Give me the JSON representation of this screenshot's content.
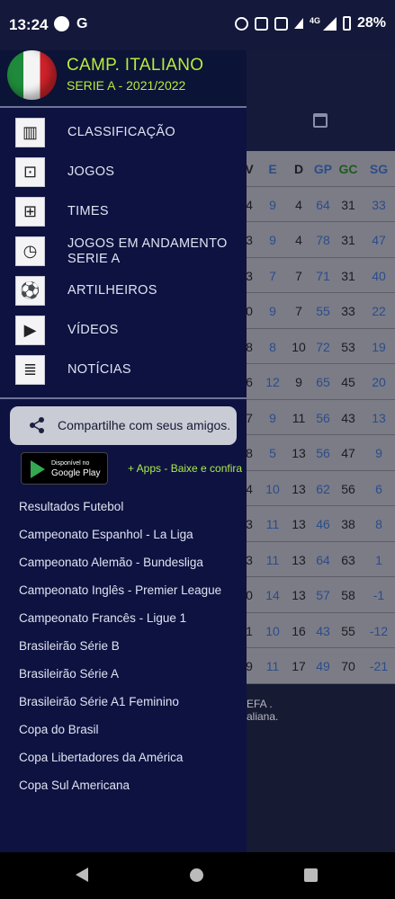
{
  "status_bar": {
    "time": "13:24",
    "google_letter": "G",
    "network": "4G",
    "battery": "28%"
  },
  "app": {
    "title": "CAMP. ITALIANO",
    "subtitle": "SERIE A - 2021/2022",
    "accent_color": "#b9ec3c"
  },
  "menu": [
    {
      "label": "CLASSIFICAÇÃO",
      "icon": "podium-icon"
    },
    {
      "label": "JOGOS",
      "icon": "scoreboard-icon"
    },
    {
      "label": "TIMES",
      "icon": "jersey-icon"
    },
    {
      "label": "JOGOS EM ANDAMENTO SERIE A",
      "icon": "stopwatch-icon"
    },
    {
      "label": "ARTILHEIROS",
      "icon": "player-icon"
    },
    {
      "label": "VÍDEOS",
      "icon": "video-icon"
    },
    {
      "label": "NOTÍCIAS",
      "icon": "newspaper-icon"
    }
  ],
  "share": {
    "label": "Compartilhe com seus amigos."
  },
  "google_play": {
    "small": "Disponível no",
    "big": "Google Play"
  },
  "more_apps": "+ Apps - Baixe e confira",
  "links": [
    "Resultados Futebol",
    "Campeonato Espanhol - La Liga",
    "Campeonato Alemão - Bundesliga",
    "Campeonato Inglês - Premier League",
    "Campeonato Francês - Ligue 1",
    "Brasileirão Série B",
    "Brasileirão Série A",
    "Brasileirão Série A1 Feminino",
    "Copa do Brasil",
    "Copa Libertadores da América",
    "Copa Sul Americana"
  ],
  "background_table": {
    "headers": [
      "V",
      "E",
      "D",
      "GP",
      "GC",
      "SG"
    ],
    "rows": [
      [
        "4",
        "9",
        "4",
        "64",
        "31",
        "33"
      ],
      [
        "3",
        "9",
        "4",
        "78",
        "31",
        "47"
      ],
      [
        "3",
        "7",
        "7",
        "71",
        "31",
        "40"
      ],
      [
        "0",
        "9",
        "7",
        "55",
        "33",
        "22"
      ],
      [
        "8",
        "8",
        "10",
        "72",
        "53",
        "19"
      ],
      [
        "6",
        "12",
        "9",
        "65",
        "45",
        "20"
      ],
      [
        "7",
        "9",
        "11",
        "56",
        "43",
        "13"
      ],
      [
        "8",
        "5",
        "13",
        "56",
        "47",
        "9"
      ],
      [
        "4",
        "10",
        "13",
        "62",
        "56",
        "6"
      ],
      [
        "3",
        "11",
        "13",
        "46",
        "38",
        "8"
      ],
      [
        "3",
        "11",
        "13",
        "64",
        "63",
        "1"
      ],
      [
        "0",
        "14",
        "13",
        "57",
        "58",
        "-1"
      ],
      [
        "1",
        "10",
        "16",
        "43",
        "55",
        "-12"
      ],
      [
        "9",
        "11",
        "17",
        "49",
        "70",
        "-21"
      ]
    ],
    "footnote_1": "EFA .",
    "footnote_2": "aliana."
  }
}
